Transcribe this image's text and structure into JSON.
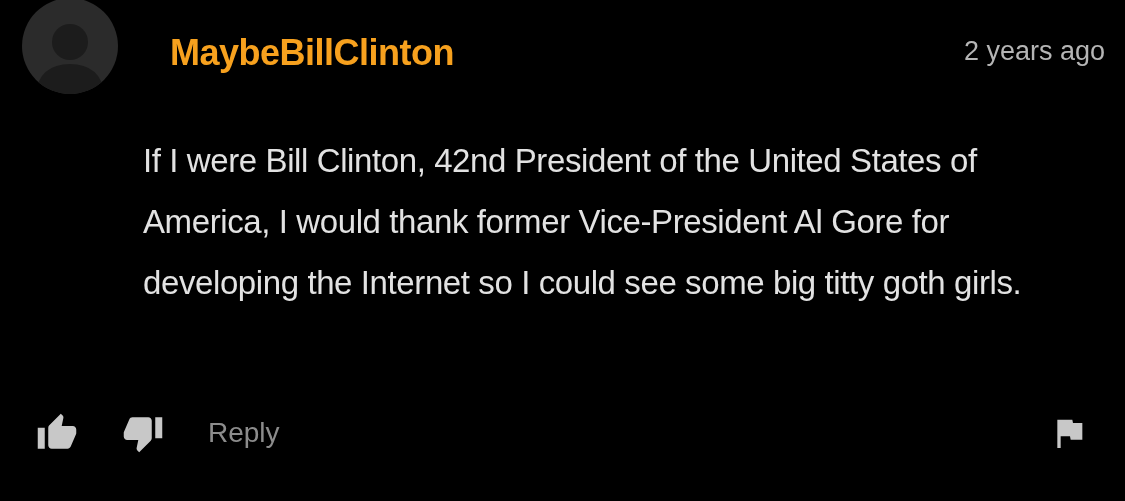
{
  "comment": {
    "username": "MaybeBillClinton",
    "time": "2 years ago",
    "text": "If I were Bill Clinton, 42nd President of the United States of America, I would thank former Vice-President Al Gore for developing the Internet so I could see some big titty goth girls.",
    "reply": "Reply"
  }
}
